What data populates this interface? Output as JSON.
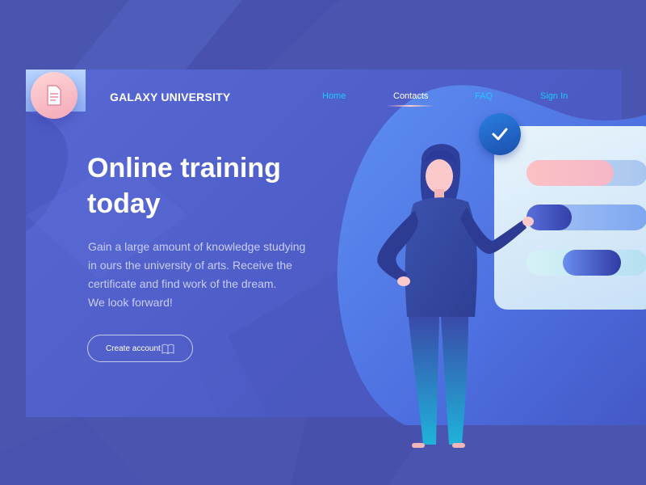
{
  "brand": {
    "name": "GALAXY UNIVERSITY",
    "logo_icon": "document-icon"
  },
  "nav": {
    "items": [
      {
        "label": "Home",
        "active": false
      },
      {
        "label": "Contacts",
        "active": true
      },
      {
        "label": "FAQ",
        "active": false
      },
      {
        "label": "Sign In",
        "active": false
      }
    ]
  },
  "hero": {
    "title_line1": "Online training",
    "title_line2": "today",
    "text_line1": "Gain a large amount of knowledge studying",
    "text_line2": "in ours the university of arts. Receive the",
    "text_line3": "certificate and find work of the dream.",
    "text_line4": "We look forward!",
    "cta_label": "Create account",
    "cta_icon": "book-icon"
  },
  "illustration": {
    "badge_icon": "check-icon"
  },
  "colors": {
    "background": "#4a55b0",
    "card": "#5868d4",
    "nav_link": "#1ec8ff",
    "accent_pink": "#f4a8b8",
    "accent_blue": "#2b7fe0"
  }
}
